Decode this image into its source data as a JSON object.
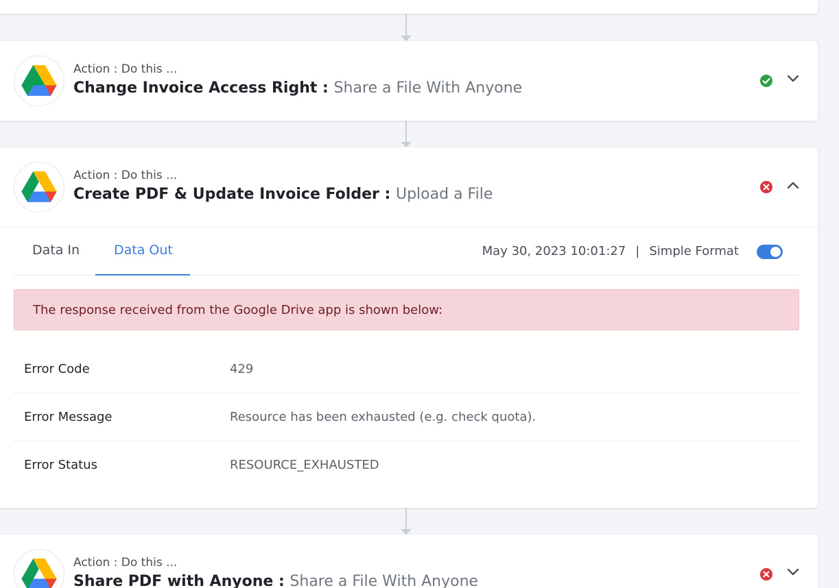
{
  "colors": {
    "accent": "#3b7ddd",
    "success": "#2e9e47",
    "error": "#d9363e",
    "alert_bg": "#f6d5da",
    "alert_text": "#6e1e27"
  },
  "steps": [
    {
      "label": "Action : Do this ...",
      "name": "Change Invoice Access Right :",
      "app_action": "Share a File With Anyone",
      "status": "success",
      "status_icon": "check-circle-icon",
      "expanded": false
    },
    {
      "label": "Action : Do this ...",
      "name": "Create PDF & Update Invoice Folder :",
      "app_action": "Upload a File",
      "status": "error",
      "status_icon": "x-circle-icon",
      "expanded": true,
      "tabs": [
        "Data In",
        "Data Out"
      ],
      "active_tab": "Data Out",
      "timestamp": "May 30, 2023 10:01:27",
      "separator": "|",
      "format_label": "Simple Format",
      "simple_format_on": true,
      "alert": "The response received from the Google Drive app is shown below:",
      "response": [
        {
          "key": "Error Code",
          "value": "429"
        },
        {
          "key": "Error Message",
          "value": "Resource has been exhausted (e.g. check quota)."
        },
        {
          "key": "Error Status",
          "value": "RESOURCE_EXHAUSTED"
        }
      ]
    },
    {
      "label": "Action : Do this ...",
      "name": "Share PDF with Anyone :",
      "app_action": "Share a File With Anyone",
      "status": "error",
      "status_icon": "x-circle-icon",
      "expanded": false
    }
  ]
}
